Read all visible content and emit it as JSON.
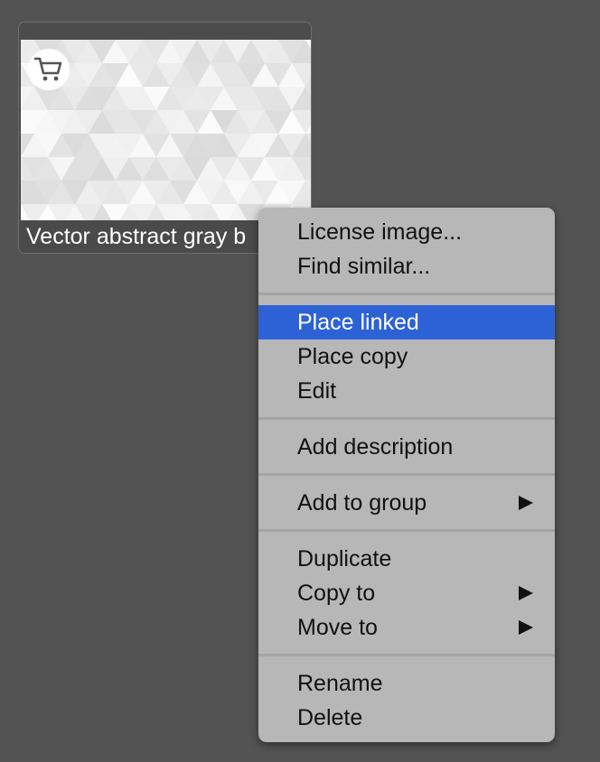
{
  "asset_card": {
    "title": "Vector abstract gray b",
    "badge_icon": "shopping-cart-icon",
    "thumbnail": "gray-triangle-mosaic-thumbnail"
  },
  "context_menu": {
    "highlight_color": "#2d62d6",
    "items": [
      {
        "label": "License image...",
        "highlighted": false,
        "submenu": false
      },
      {
        "label": "Find similar...",
        "highlighted": false,
        "submenu": false
      },
      {
        "label": "Place linked",
        "highlighted": true,
        "submenu": false
      },
      {
        "label": "Place copy",
        "highlighted": false,
        "submenu": false
      },
      {
        "label": "Edit",
        "highlighted": false,
        "submenu": false
      },
      {
        "label": "Add description",
        "highlighted": false,
        "submenu": false
      },
      {
        "label": "Add to group",
        "highlighted": false,
        "submenu": true
      },
      {
        "label": "Duplicate",
        "highlighted": false,
        "submenu": false
      },
      {
        "label": "Copy to",
        "highlighted": false,
        "submenu": true
      },
      {
        "label": "Move to",
        "highlighted": false,
        "submenu": true
      },
      {
        "label": "Rename",
        "highlighted": false,
        "submenu": false
      },
      {
        "label": "Delete",
        "highlighted": false,
        "submenu": false
      }
    ]
  }
}
